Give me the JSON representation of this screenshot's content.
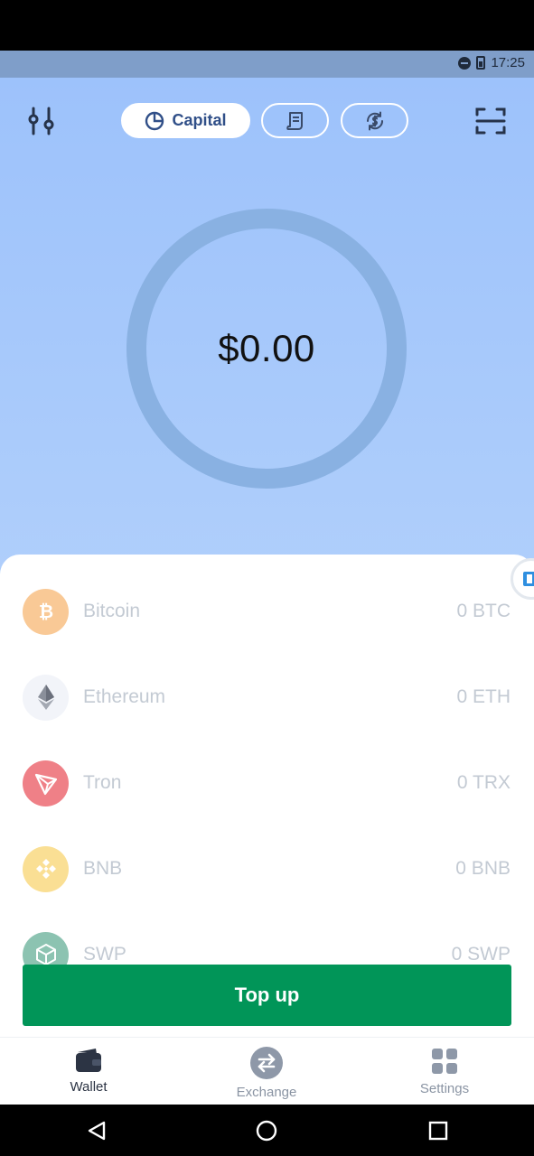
{
  "status_bar": {
    "time": "17:25"
  },
  "header": {
    "segments": [
      {
        "label": "Capital",
        "icon": "pie-chart-icon",
        "selected": true
      },
      {
        "label": "",
        "icon": "receipt-icon",
        "selected": false
      },
      {
        "label": "",
        "icon": "exchange-circle-icon",
        "selected": false
      }
    ]
  },
  "balance": {
    "total": "$0.00"
  },
  "coins": [
    {
      "name": "Bitcoin",
      "amount": "0 BTC",
      "color": "#f7931a"
    },
    {
      "name": "Ethereum",
      "amount": "0 ETH",
      "color": "#627eea"
    },
    {
      "name": "Tron",
      "amount": "0 TRX",
      "color": "#e0343b"
    },
    {
      "name": "BNB",
      "amount": "0 BNB",
      "color": "#f3ba2f"
    },
    {
      "name": "SWP",
      "amount": "0 SWP",
      "color": "#2d8a6e"
    }
  ],
  "actions": {
    "top_up": "Top up"
  },
  "tabs": [
    {
      "label": "Wallet",
      "icon": "wallet-icon",
      "active": true
    },
    {
      "label": "Exchange",
      "icon": "exchange-icon",
      "active": false
    },
    {
      "label": "Settings",
      "icon": "settings-grid-icon",
      "active": false
    }
  ],
  "colors": {
    "accent": "#019558",
    "header_bg": "#9dc2fb",
    "ring": "#89b1e2"
  }
}
